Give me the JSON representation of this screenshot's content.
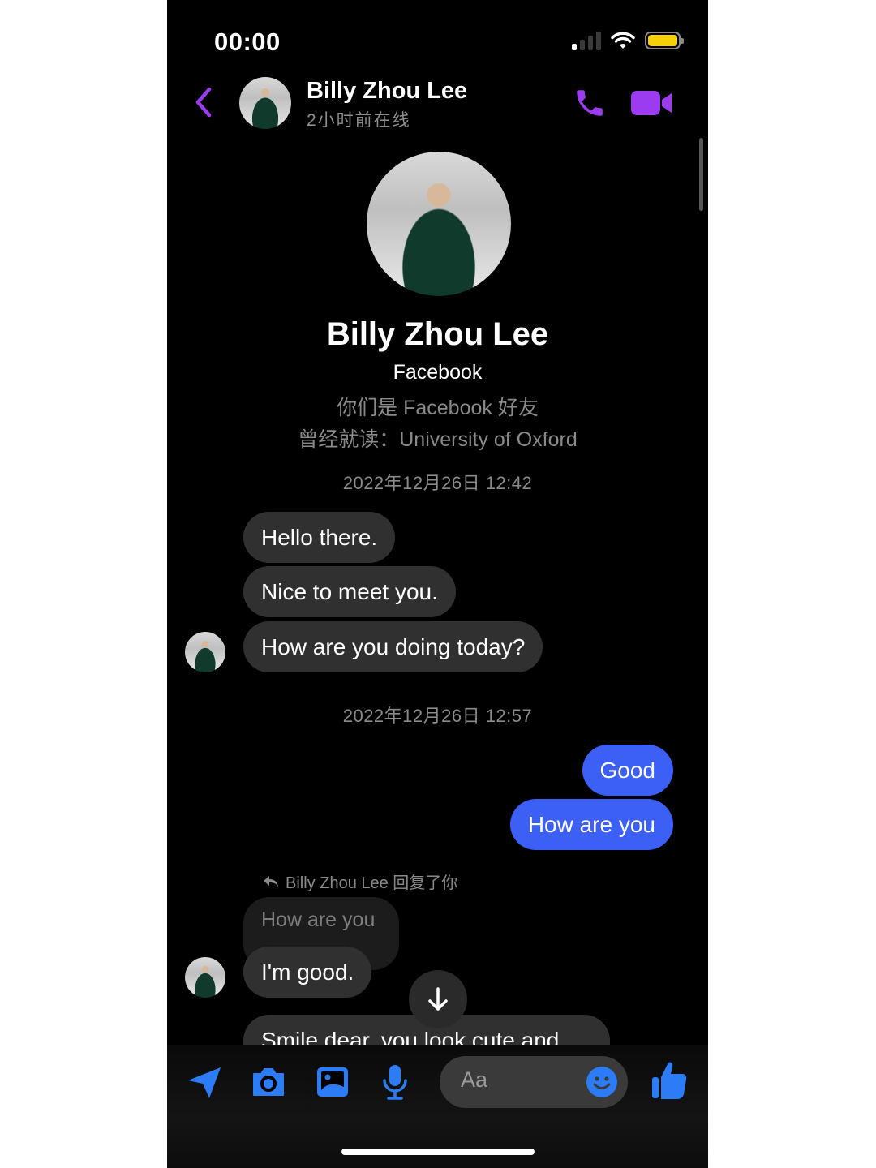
{
  "status_bar": {
    "time": "00:00",
    "battery_color": "#f5cf0a"
  },
  "header": {
    "contact_name": "Billy Zhou Lee",
    "presence": "2小时前在线",
    "accent_color": "#9b3cf0",
    "icons": [
      "back-chevron-icon",
      "phone-icon",
      "video-camera-icon"
    ]
  },
  "profile": {
    "name": "Billy Zhou Lee",
    "platform": "Facebook",
    "friend_status": "你们是 Facebook 好友",
    "education": "曾经就读：University of Oxford"
  },
  "conversation": {
    "timestamps": [
      "2022年12月26日 12:42",
      "2022年12月26日 12:57"
    ],
    "incoming_group_1": [
      "Hello there.",
      "Nice to meet you.",
      "How are you doing today?"
    ],
    "outgoing_group": [
      "Good",
      "How are you"
    ],
    "reply": {
      "label": "Billy Zhou Lee 回复了你",
      "quoted_text": "How are you",
      "message": "I'm good."
    },
    "partial_message": "Smile dear, you look cute and"
  },
  "composer": {
    "placeholder": "Aa",
    "accent_color": "#2b7cf6",
    "tools": [
      "location-arrow-icon",
      "camera-icon",
      "gallery-icon",
      "microphone-icon"
    ],
    "emoji_icon": "emoji-icon",
    "like_icon": "thumbs-up-icon"
  },
  "colors": {
    "outgoing_bubble": "#3c5ff5",
    "incoming_bubble": "#303030"
  }
}
